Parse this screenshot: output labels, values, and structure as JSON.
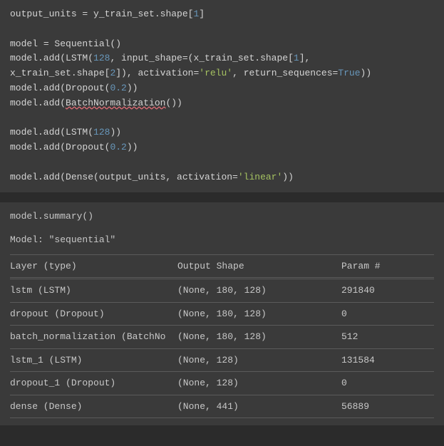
{
  "code1": {
    "l1a": "output_units ",
    "l1b": "= ",
    "l1c": "y_train_set.shape[",
    "l1d": "1",
    "l1e": "]",
    "l2": "",
    "l3a": "model ",
    "l3b": "= ",
    "l3c": "Sequential()",
    "l4a": "model.add(LSTM(",
    "l4b": "128",
    "l4c": ", input_shape=(x_train_set.shape[",
    "l4d": "1",
    "l4e": "],",
    "l5a": "x_train_set.shape[",
    "l5b": "2",
    "l5c": "]), activation=",
    "l5d": "'relu'",
    "l5e": ", return_sequences=",
    "l5f": "True",
    "l5g": "))",
    "l6a": "model.add(Dropout(",
    "l6b": "0.2",
    "l6c": "))",
    "l7a": "model.add(",
    "l7b": "BatchNormalization",
    "l7c": "())",
    "l8": "",
    "l9a": "model.add(LSTM(",
    "l9b": "128",
    "l9c": "))",
    "l10a": "model.add(Dropout(",
    "l10b": "0.2",
    "l10c": "))",
    "l11": "",
    "l12a": "model.add(Dense(output_units, activation=",
    "l12b": "'linear'",
    "l12c": "))"
  },
  "code2": {
    "l1": "model.summary()"
  },
  "output": {
    "model_name": "Model: \"sequential\"",
    "header": {
      "layer": "Layer (type)",
      "shape": "Output Shape",
      "param": "Param #"
    },
    "rows": [
      {
        "layer": "lstm (LSTM)",
        "shape": "(None, 180, 128)",
        "param": "291840"
      },
      {
        "layer": "dropout (Dropout)",
        "shape": "(None, 180, 128)",
        "param": "0"
      },
      {
        "layer": "batch_normalization (BatchNo",
        "shape": "(None, 180, 128)",
        "param": "512"
      },
      {
        "layer": "lstm_1 (LSTM)",
        "shape": "(None, 128)",
        "param": "131584"
      },
      {
        "layer": "dropout_1 (Dropout)",
        "shape": "(None, 128)",
        "param": "0"
      },
      {
        "layer": "dense (Dense)",
        "shape": "(None, 441)",
        "param": "56889"
      }
    ]
  },
  "chart_data": {
    "type": "table",
    "title": "Model: \"sequential\"",
    "columns": [
      "Layer (type)",
      "Output Shape",
      "Param #"
    ],
    "rows": [
      [
        "lstm (LSTM)",
        "(None, 180, 128)",
        291840
      ],
      [
        "dropout (Dropout)",
        "(None, 180, 128)",
        0
      ],
      [
        "batch_normalization (BatchNo",
        "(None, 180, 128)",
        512
      ],
      [
        "lstm_1 (LSTM)",
        "(None, 128)",
        131584
      ],
      [
        "dropout_1 (Dropout)",
        "(None, 128)",
        0
      ],
      [
        "dense (Dense)",
        "(None, 441)",
        56889
      ]
    ]
  }
}
